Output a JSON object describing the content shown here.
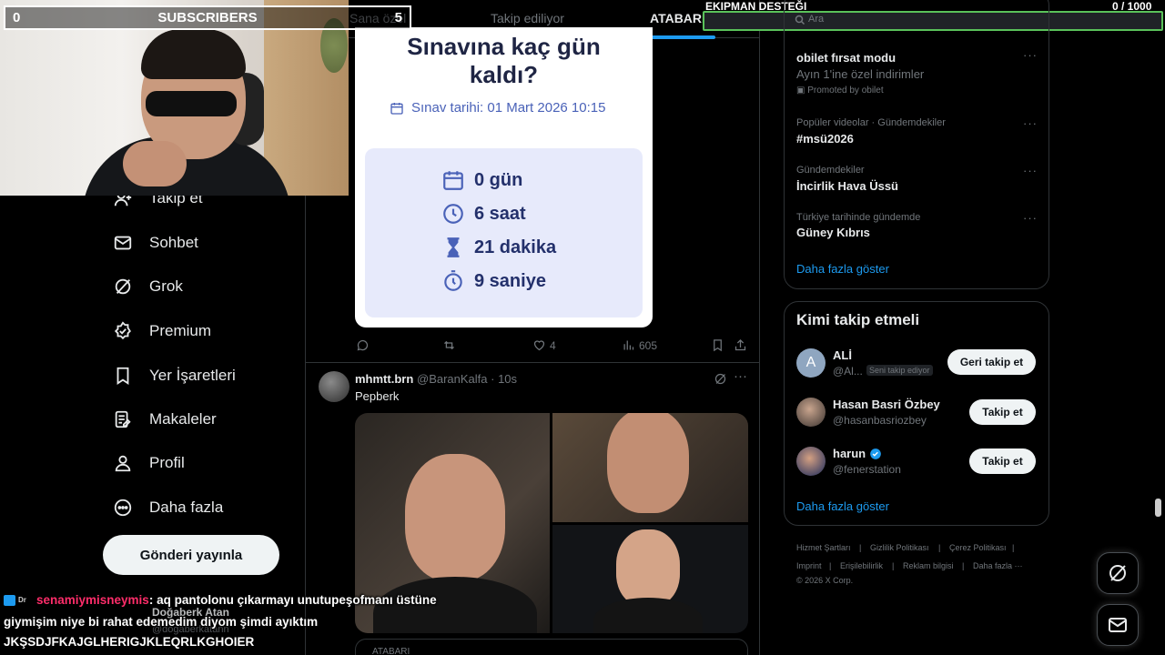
{
  "subscriber_bar": {
    "current": "0",
    "label": "SUBSCRIBERS",
    "goal": "5",
    "progress": 0
  },
  "equipment_bar": {
    "label": "EKIPMAN DESTEĞI",
    "count": "0 / 1000"
  },
  "search": {
    "placeholder": "Ara"
  },
  "tabs": [
    {
      "label": "Sana özel"
    },
    {
      "label": "Takip ediliyor"
    },
    {
      "label": "ATABARI",
      "active": true
    }
  ],
  "nav": {
    "items": [
      {
        "label": "Takip et",
        "icon": "follow-icon"
      },
      {
        "label": "Sohbet",
        "icon": "mail-icon"
      },
      {
        "label": "Grok",
        "icon": "grok-icon"
      },
      {
        "label": "Premium",
        "icon": "verified-icon"
      },
      {
        "label": "Yer İşaretleri",
        "icon": "bookmark-icon"
      },
      {
        "label": "Makaleler",
        "icon": "article-icon"
      },
      {
        "label": "Profil",
        "icon": "person-icon"
      },
      {
        "label": "Daha fazla",
        "icon": "more-circle-icon"
      }
    ],
    "post_button": "Gönderi yayınla"
  },
  "countdown_card": {
    "title_line1": "Sınavına kaç gün",
    "title_line2": "kaldı?",
    "exam_date": "Sınav tarihi: 01 Mart 2026 10:15",
    "days": "0 gün",
    "hours": "6 saat",
    "minutes": "21 dakika",
    "seconds": "9 saniye"
  },
  "tweet1_actions": {
    "likes": "4",
    "views": "605"
  },
  "tweet2": {
    "name": "mhmtt.brn",
    "handle": "@BaranKalfa · 10s",
    "text": "Pepberk",
    "footer_label": "ATABARI"
  },
  "trends": {
    "items": [
      {
        "category": "obilet fırsat modu",
        "title": "Ayın 1'ine özel indirimler",
        "sub": "Promoted by obilet"
      },
      {
        "category": "Popüler videolar · Gündemdekiler",
        "title": "#msü2026"
      },
      {
        "category": "Gündemdekiler",
        "title": "İncirlik Hava Üssü"
      },
      {
        "category": "Türkiye tarihinde gündemde",
        "title": "Güney Kıbrıs"
      }
    ],
    "show_more": "Daha fazla göster"
  },
  "who_to_follow": {
    "title": "Kimi takip etmeli",
    "accounts": [
      {
        "name": "ALİ",
        "handle": "@Al...",
        "badge": "Seni takip ediyor",
        "button": "Geri takip et",
        "initial": "A"
      },
      {
        "name": "Hasan Basri Özbey",
        "handle": "@hasanbasriozbey",
        "button": "Takip et"
      },
      {
        "name": "harun",
        "handle": "@fenerstation",
        "button": "Takip et",
        "verified": true
      }
    ],
    "show_more": "Daha fazla göster"
  },
  "footer": {
    "links": [
      "Hizmet Şartları",
      "Gizlilik Politikası",
      "Çerez Politikası",
      "Imprint",
      "Erişilebilirlik",
      "Reklam bilgisi",
      "Daha fazla ···"
    ],
    "copyright": "© 2026 X Corp."
  },
  "chat": {
    "badge_text": "Dr",
    "username": "senamiymisneymis",
    "line1": ": aq pantolonu çıkarmayı unutupeşofmanı üstüne",
    "line2": "giymişim niye bi rahat edemedim diyom şimdi ayıktım",
    "line3": "JKŞSDJFKAJGLHERIGJKLEQRLKGHOIER"
  },
  "ghost_user": {
    "name": "Doğaberk Atan",
    "handle": "@dogaberkatann"
  },
  "colors": {
    "accent": "#1d9bf0",
    "background": "#000000",
    "card_bg": "#e7eafb",
    "equip_border": "#5ac25a",
    "chat_username": "#ff2d6a"
  }
}
